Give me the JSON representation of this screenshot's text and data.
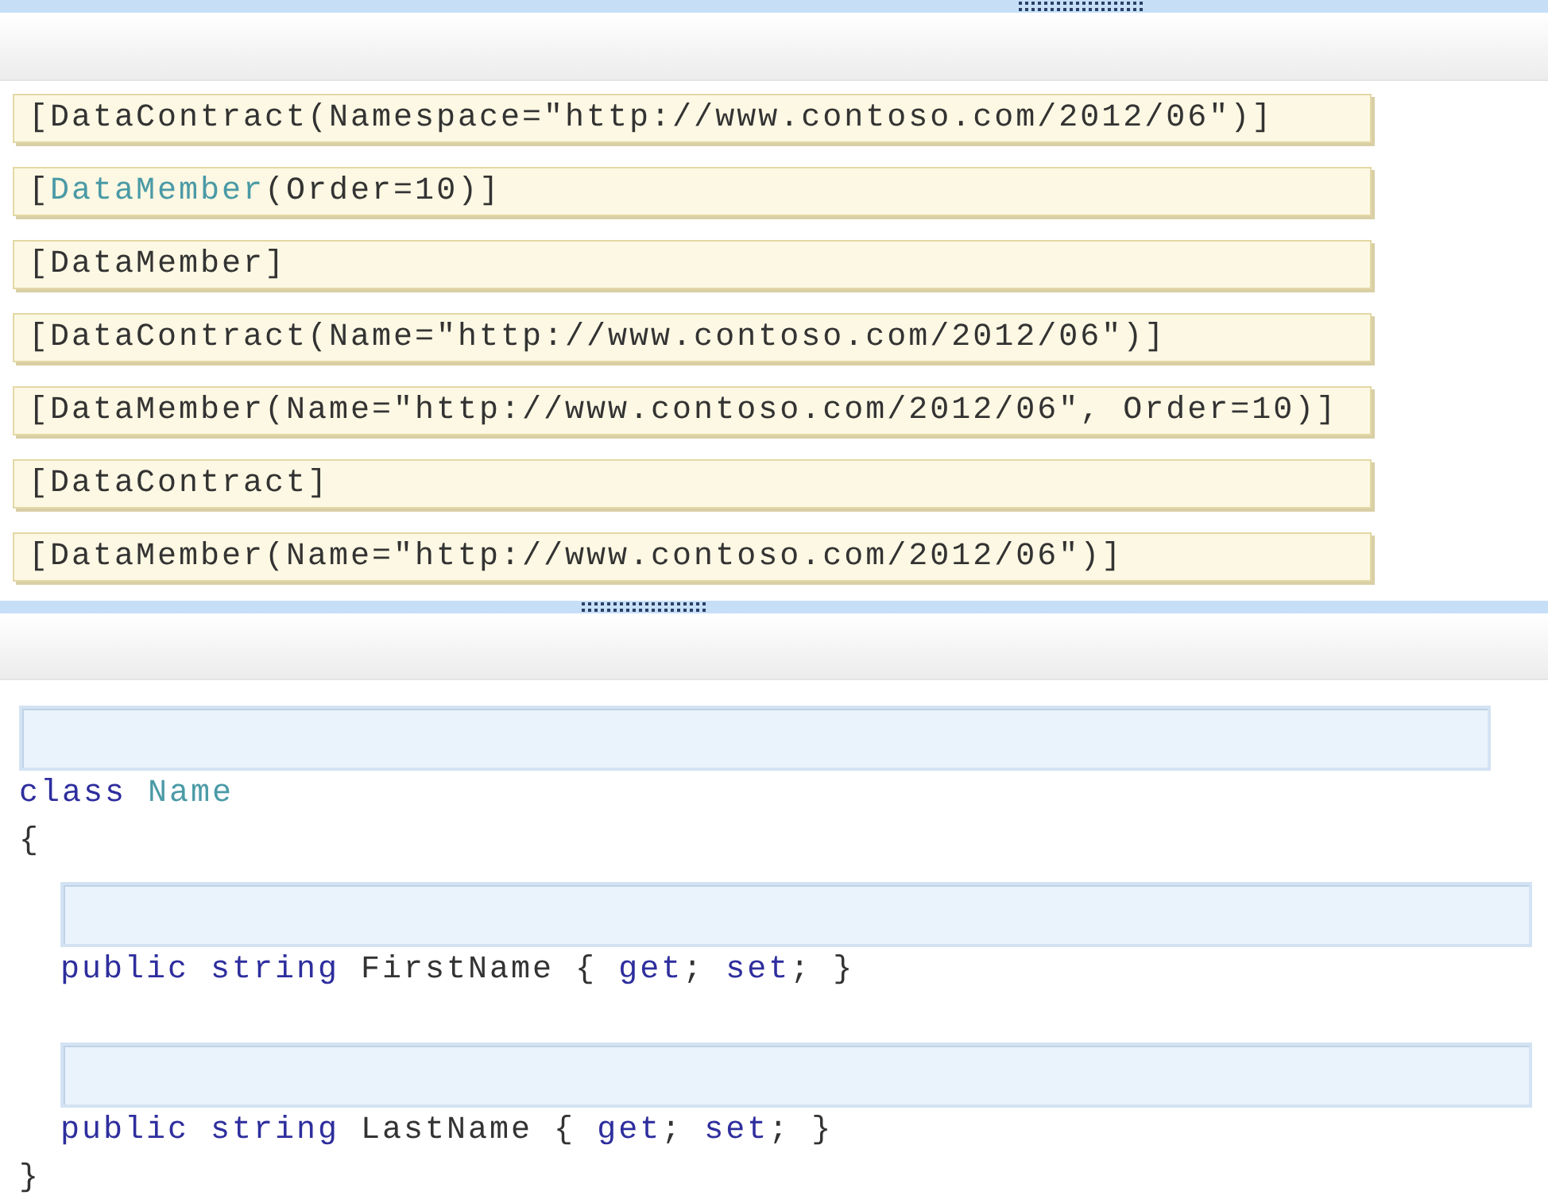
{
  "answer_tiles": [
    {
      "tokens": [
        {
          "kind": "plain",
          "text": "[DataContract(Namespace=\"http://www.contoso.com/2012/06\")]"
        }
      ]
    },
    {
      "tokens": [
        {
          "kind": "plain",
          "text": "["
        },
        {
          "kind": "type",
          "text": "DataMember"
        },
        {
          "kind": "plain",
          "text": "(Order=10)]"
        }
      ]
    },
    {
      "tokens": [
        {
          "kind": "plain",
          "text": "[DataMember]"
        }
      ]
    },
    {
      "tokens": [
        {
          "kind": "plain",
          "text": "[DataContract(Name=\"http://www.contoso.com/2012/06\")]"
        }
      ]
    },
    {
      "tokens": [
        {
          "kind": "plain",
          "text": "[DataMember(Name=\"http://www.contoso.com/2012/06\", Order=10)]"
        }
      ]
    },
    {
      "tokens": [
        {
          "kind": "plain",
          "text": "[DataContract]"
        }
      ]
    },
    {
      "tokens": [
        {
          "kind": "plain",
          "text": "[DataMember(Name=\"http://www.contoso.com/2012/06\")]"
        }
      ]
    }
  ],
  "code": [
    {
      "kind": "drop_zone"
    },
    {
      "kind": "line",
      "tokens": [
        {
          "kind": "keyword",
          "text": "class"
        },
        {
          "kind": "type",
          "text": " Name"
        }
      ]
    },
    {
      "kind": "line",
      "tokens": [
        {
          "kind": "plain",
          "text": "{"
        }
      ]
    },
    {
      "kind": "block",
      "children": [
        {
          "kind": "drop_zone"
        },
        {
          "kind": "line",
          "tokens": [
            {
              "kind": "keyword",
              "text": "public string"
            },
            {
              "kind": "plain",
              "text": " FirstName { "
            },
            {
              "kind": "keyword",
              "text": "get"
            },
            {
              "kind": "plain",
              "text": "; "
            },
            {
              "kind": "keyword",
              "text": "set"
            },
            {
              "kind": "plain",
              "text": "; }"
            }
          ]
        },
        {
          "kind": "blank"
        },
        {
          "kind": "drop_zone"
        },
        {
          "kind": "line",
          "tokens": [
            {
              "kind": "keyword",
              "text": "public string"
            },
            {
              "kind": "plain",
              "text": " LastName { "
            },
            {
              "kind": "keyword",
              "text": "get"
            },
            {
              "kind": "plain",
              "text": "; "
            },
            {
              "kind": "keyword",
              "text": "set"
            },
            {
              "kind": "plain",
              "text": "; }"
            }
          ]
        }
      ]
    },
    {
      "kind": "line",
      "tokens": [
        {
          "kind": "plain",
          "text": "}"
        }
      ]
    }
  ]
}
